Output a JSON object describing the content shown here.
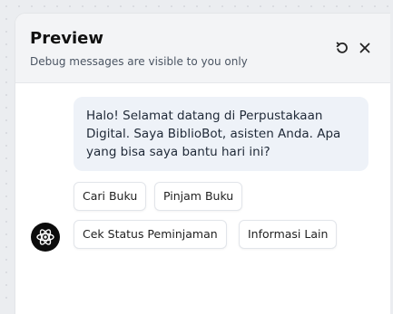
{
  "preview": {
    "title": "Preview",
    "subtitle": "Debug messages are visible to you only"
  },
  "header_icons": {
    "refresh": "refresh-icon",
    "close": "close-icon"
  },
  "bot": {
    "avatar_icon": "atom-icon",
    "message": "Halo! Selamat datang di Perpustakaan Digital. Saya BiblioBot, asisten Anda. Apa yang bisa saya bantu hari ini?"
  },
  "quick_replies": [
    {
      "label": "Cari Buku"
    },
    {
      "label": "Pinjam Buku"
    },
    {
      "label": "Cek Status Peminjaman"
    },
    {
      "label": "Informasi Lain"
    }
  ],
  "colors": {
    "header_bg": "#f3f4f6",
    "bubble_bg": "#eef2f8",
    "avatar_bg": "#0c0c0c",
    "canvas_bg": "#ebedf0"
  }
}
